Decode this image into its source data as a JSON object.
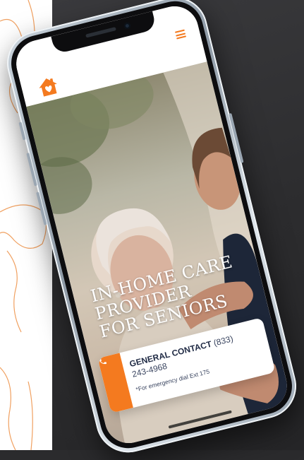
{
  "brand": {
    "accent": "#f47a1f",
    "navy": "#1f2a44"
  },
  "header": {
    "logo_icon": "house-with-heart-icon",
    "menu_icon": "hamburger-menu-icon"
  },
  "hero": {
    "title": "IN-HOME CARE\nPROVIDER\nFOR SENIORS"
  },
  "contact": {
    "label": "GENERAL CONTACT",
    "number_part1": "(833)",
    "number_part2": "243-4968",
    "note": "*For emergency dial Ext 175",
    "icon": "phone-icon"
  }
}
